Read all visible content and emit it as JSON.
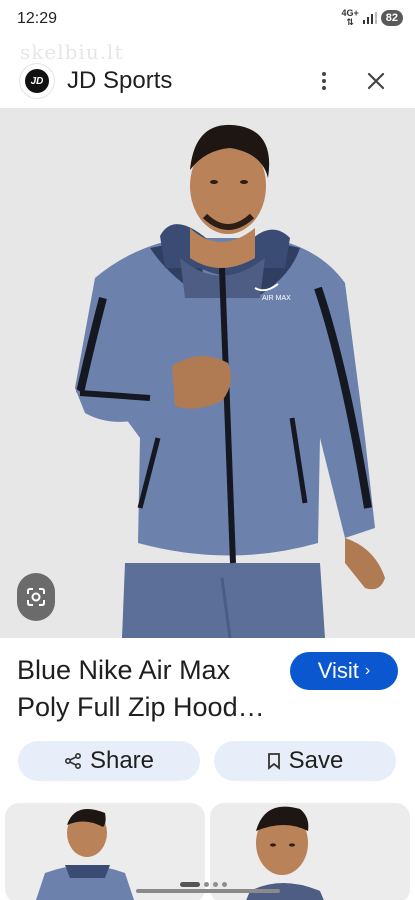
{
  "status_bar": {
    "time": "12:29",
    "network": "4G+",
    "battery": "82"
  },
  "watermark": "skelbiu.lt",
  "header": {
    "logo_text": "JD",
    "site_name": "JD Sports"
  },
  "product": {
    "title": "Blue Nike Air Max Poly Full Zip Hood…"
  },
  "actions": {
    "visit_label": "Visit",
    "share_label": "Share",
    "save_label": "Save"
  },
  "colors": {
    "accent": "#0b57d0",
    "pill_bg": "#e8eef9",
    "jacket": "#6c82ad"
  },
  "pagination": {
    "pages": 4,
    "current": 1
  }
}
